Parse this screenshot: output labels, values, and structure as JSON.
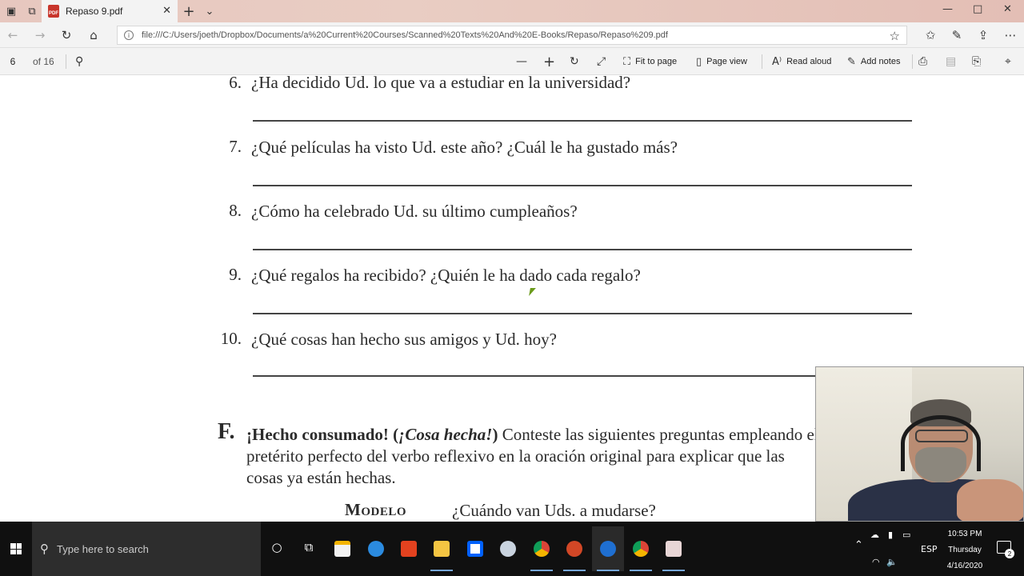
{
  "browser": {
    "tab_title": "Repaso 9.pdf",
    "new_tab": "+",
    "tab_menu": "⌄",
    "url": "file:///C:/Users/joeth/Dropbox/Documents/a%20Current%20Courses/Scanned%20Texts%20And%20E-Books/Repaso/Repaso%209.pdf",
    "window_controls": {
      "minimize": "—",
      "maximize": "□",
      "close": "✕"
    }
  },
  "pdf_toolbar": {
    "page_current": "6",
    "page_total": "of 16",
    "fit_to_page": "Fit to page",
    "page_view": "Page view",
    "read_aloud": "Read aloud",
    "add_notes": "Add notes"
  },
  "document": {
    "questions": [
      {
        "num": "6.",
        "text": "¿Ha decidido Ud. lo que va a estudiar en la universidad?"
      },
      {
        "num": "7.",
        "text": "¿Qué películas ha visto Ud. este año? ¿Cuál le ha gustado más?"
      },
      {
        "num": "8.",
        "text": "¿Cómo ha celebrado Ud. su último cumpleaños?"
      },
      {
        "num": "9.",
        "text": "¿Qué regalos ha recibido? ¿Quién le ha dado cada regalo?"
      },
      {
        "num": "10.",
        "text": "¿Qué cosas han hecho sus amigos y Ud. hoy?"
      }
    ],
    "section": {
      "letter": "F.",
      "title_bold": "¡Hecho consumado! (",
      "title_italic": "¡Cosa hecha!",
      "title_close": ")",
      "instructions": " Conteste las siguientes preguntas empleando el pretérito perfecto del verbo reflexivo en la oración original para explicar que las cosas ya están hechas.",
      "model_label": "Modelo",
      "model_question": "¿Cuándo van Uds. a mudarse?"
    }
  },
  "taskbar": {
    "search_placeholder": "Type here to search",
    "language": "ESP",
    "time": "10:53 PM",
    "day": "Thursday",
    "date": "4/16/2020",
    "notification_count": "2"
  }
}
